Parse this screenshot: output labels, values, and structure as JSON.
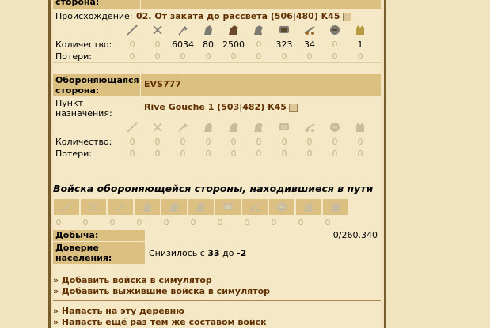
{
  "attacker": {
    "side_label": "сторона:",
    "origin_label": "Происхождение:",
    "origin_village": "02. От заката до рассвета (506|480) K45",
    "quantity_label": "Количество:",
    "losses_label": "Потери:",
    "quantity": [
      "0",
      "0",
      "6034",
      "80",
      "2500",
      "0",
      "323",
      "34",
      "0",
      "1"
    ],
    "losses": [
      "0",
      "0",
      "0",
      "0",
      "0",
      "0",
      "0",
      "0",
      "0",
      "0"
    ]
  },
  "defender": {
    "side_label": "Обороняющаяся сторона:",
    "player": "EVS777",
    "destination_label": "Пункт назначения:",
    "destination_village": "Rive Gouche 1 (503|482) K45",
    "quantity_label": "Количество:",
    "losses_label": "Потери:",
    "quantity": [
      "0",
      "0",
      "0",
      "0",
      "0",
      "0",
      "0",
      "0",
      "0",
      "0"
    ],
    "losses": [
      "0",
      "0",
      "0",
      "0",
      "0",
      "0",
      "0",
      "0",
      "0",
      "0"
    ]
  },
  "on_way": {
    "title": "Войска обороняющейся стороны, находившиеся в пути",
    "values": [
      "0",
      "0",
      "0",
      "0",
      "0",
      "0",
      "0",
      "0",
      "0",
      "0",
      "0"
    ]
  },
  "unit_icons": [
    "spear-icon",
    "sword-icon",
    "axe-icon",
    "spy-icon",
    "light-cavalry-icon",
    "heavy-cavalry-icon",
    "ram-icon",
    "catapult-icon",
    "knight-icon",
    "snob-icon"
  ],
  "loot": {
    "label": "Добыча:",
    "value": "0/260.340"
  },
  "loyalty": {
    "label": "Доверие населения:",
    "text_prefix": "Снизилось с ",
    "from": "33",
    "text_mid": " до ",
    "to": "-2"
  },
  "links": {
    "add_sim": "» Добавить войска в симулятор",
    "add_survivors": "» Добавить выжившие войска в симулятор",
    "attack_village": "» Напасть на эту деревню",
    "attack_again": "» Напасть ещё раз тем же составом войск"
  },
  "colors": {
    "header_bg": "#dcc082",
    "page_bg": "#f1e3c0",
    "link": "#603000",
    "zero": "#c5b48a"
  }
}
